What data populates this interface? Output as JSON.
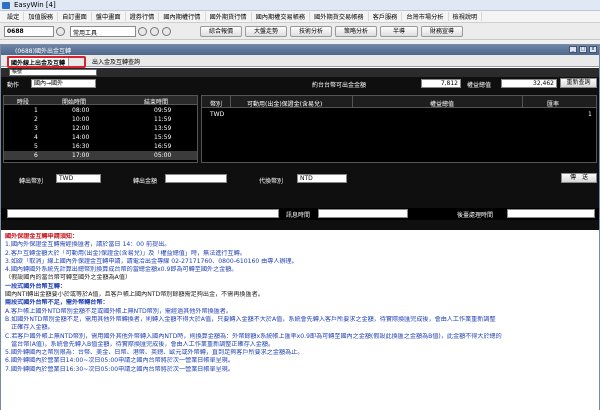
{
  "app": {
    "title": "EasyWin  [4]"
  },
  "menu": [
    "設定",
    "加值服務",
    "自訂畫面",
    "盤中畫面",
    "證券行情",
    "國內期權行情",
    "國外期貨行情",
    "國內期權交易帳務",
    "國外期貨交易帳務",
    "客戶服務",
    "台灣市場分析",
    "檢視說明"
  ],
  "toolbar": {
    "code": "0688",
    "tool_select": "常用工具",
    "buttons": [
      "綜合報價",
      "大盤走勢",
      "技術分析",
      "策略分析",
      "半導",
      "財務宣導"
    ]
  },
  "window": {
    "title": "(0688)國外出金互轉",
    "tabs": [
      "國外線上出金及互轉",
      "出入金及互轉查詢"
    ],
    "account_select": "帳號"
  },
  "transfer": {
    "action_label": "動作",
    "action_value": "國內→國外",
    "available_label": "約台台幣可出金金額",
    "available_value": "7,812",
    "equity_label": "權益總值",
    "equity_value": "32,462",
    "refresh_label": "重新查詢"
  },
  "sessions": {
    "headers": [
      "時段",
      "開始時間",
      "結束時間"
    ],
    "rows": [
      [
        "1",
        "08:00",
        "09:59"
      ],
      [
        "2",
        "10:00",
        "11:59"
      ],
      [
        "3",
        "12:00",
        "13:59"
      ],
      [
        "4",
        "14:00",
        "15:59"
      ],
      [
        "5",
        "16:30",
        "16:59"
      ],
      [
        "6",
        "17:00",
        "05:00"
      ]
    ]
  },
  "currency_table": {
    "headers": [
      "幣別",
      "可動用(出金)保證金(含易兌)",
      "權益總值",
      "匯率"
    ],
    "rows": [
      [
        "TWD",
        "",
        "",
        "1"
      ]
    ]
  },
  "form": {
    "out_currency_label": "轉出幣別",
    "out_currency_value": "TWD",
    "out_amount_label": "轉出金額",
    "exchange_currency_label": "代換幣別",
    "exchange_currency_value": "NTD",
    "send_label": "傳　送"
  },
  "status": {
    "message_time_label": "訊息時間",
    "process_time_label": "後臺處理時間"
  },
  "notes": [
    {
      "style": "red",
      "text": "國外保證金互轉申請須知："
    },
    {
      "style": "blue",
      "text": "1.國內外保證金互轉需經換匯者，請於當日 14：00 前提出。"
    },
    {
      "style": "blue",
      "text": "2.客戶互轉金額大於「可動用(出金)保證金(含易兌)」及「權益總值」時，無法進行互轉。"
    },
    {
      "style": "blue",
      "text": "3.如欲「取消」線上國內外保證金互轉申請，請電洽出金專線 02-27171760、0800-610160 由專人辦理。"
    },
    {
      "style": "blue",
      "text": "4.國內轉國外系統先計算出總幣別換算成台幣的當總金額x0.9即為可轉至國外之金額。"
    },
    {
      "style": "dark",
      "text": "（假設國內的當台幣可轉至國外之金額為A值）"
    },
    {
      "style": "blue-b",
      "text": "一段式國外台幣互轉："
    },
    {
      "style": "dark",
      "text": "國內NTI轉出金額要小於或等於A值，且客戶帳上國內NTD幣別餘額需足夠出金，不需再換匯者。"
    },
    {
      "style": "blue-b",
      "text": "兩段式國外台幣不足，需外幣轉台幣："
    },
    {
      "style": "blue",
      "text": "A.客戶帳上國外NTD幣別金額不足或國外帳上無NTD幣別，需經過其他外幣換匯者。"
    },
    {
      "style": "blue",
      "text": "B.如國外NTD幣別金額不足，需用其他外幣轉換者，則轉入金額不得大於A值，只要轉入金額不大於A值，系統會先轉入客戶所要求之金額，待實際換匯完成後，會由人工作業重新調整"
    },
    {
      "style": "blue",
      "text": "　正確存入金額。"
    },
    {
      "style": "blue",
      "text": "C.若客戶國外帳上無NTD幣別，需用國外其他外幣轉入國內NTD時，則換算金額為：外幣餘額x系統帳上匯率x0.9即為可轉至國內之金額(假設此換匯之金額為B值)，此金額不得大於總的"
    },
    {
      "style": "blue",
      "text": "　當台幣(A值)，系統會先轉入B值金額，待實際換匯完成後，會由人工作業重新調整正確存入金額。"
    },
    {
      "style": "blue",
      "text": "5.國外轉國內之幣別限為：台幣、美金、日幣、港幣、英鎊、歐元或外幣轉，直到足夠客戶所要求之金額為止。"
    },
    {
      "style": "blue",
      "text": "6.國外轉國內於營業日14:00~次日05:00申請之國內台幣將於次一營業日帳單呈現。"
    },
    {
      "style": "blue",
      "text": "7.國外轉國內於營業日16:30~次日05:00申請之國內台幣將於次一營業日帳單呈現。"
    }
  ],
  "colors": {
    "accent_red": "#d8232a",
    "dark_bg": "#0f0f0f",
    "note_blue": "#1e3fb5",
    "note_red": "#c8161d"
  },
  "icons": [
    "app-icon",
    "search-icon",
    "settings-icon",
    "minimize-icon",
    "maximize-icon",
    "close-icon",
    "dropdown-icon"
  ]
}
